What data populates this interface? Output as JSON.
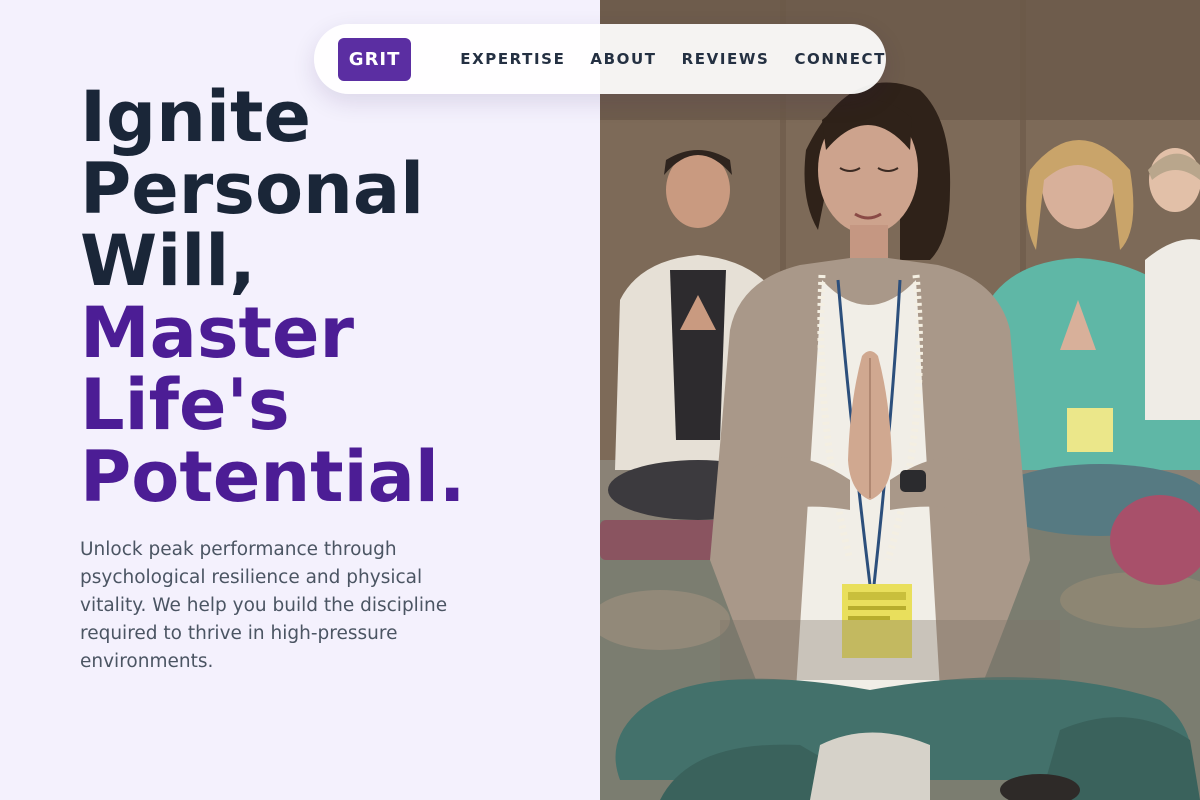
{
  "nav": {
    "brand": "GRIT",
    "links": [
      "EXPERTISE",
      "ABOUT",
      "REVIEWS",
      "CONNECT"
    ]
  },
  "hero": {
    "headline_dark": [
      "Ignite",
      "Personal",
      "Will,"
    ],
    "headline_accent": [
      "Master",
      "Life's",
      "Potential."
    ],
    "description": "Unlock peak performance through psychological resilience and physical vitality. We help you build the discipline required to thrive in high-pressure environments.",
    "image_alt": "Group of people meditating cross-legged with hands in prayer position"
  },
  "colors": {
    "page_background": "#f4f1fd",
    "brand_purple": "#5b2ea2",
    "headline_dark": "#1a2638",
    "headline_accent": "#4c1d95",
    "body_text": "#4b5563"
  }
}
